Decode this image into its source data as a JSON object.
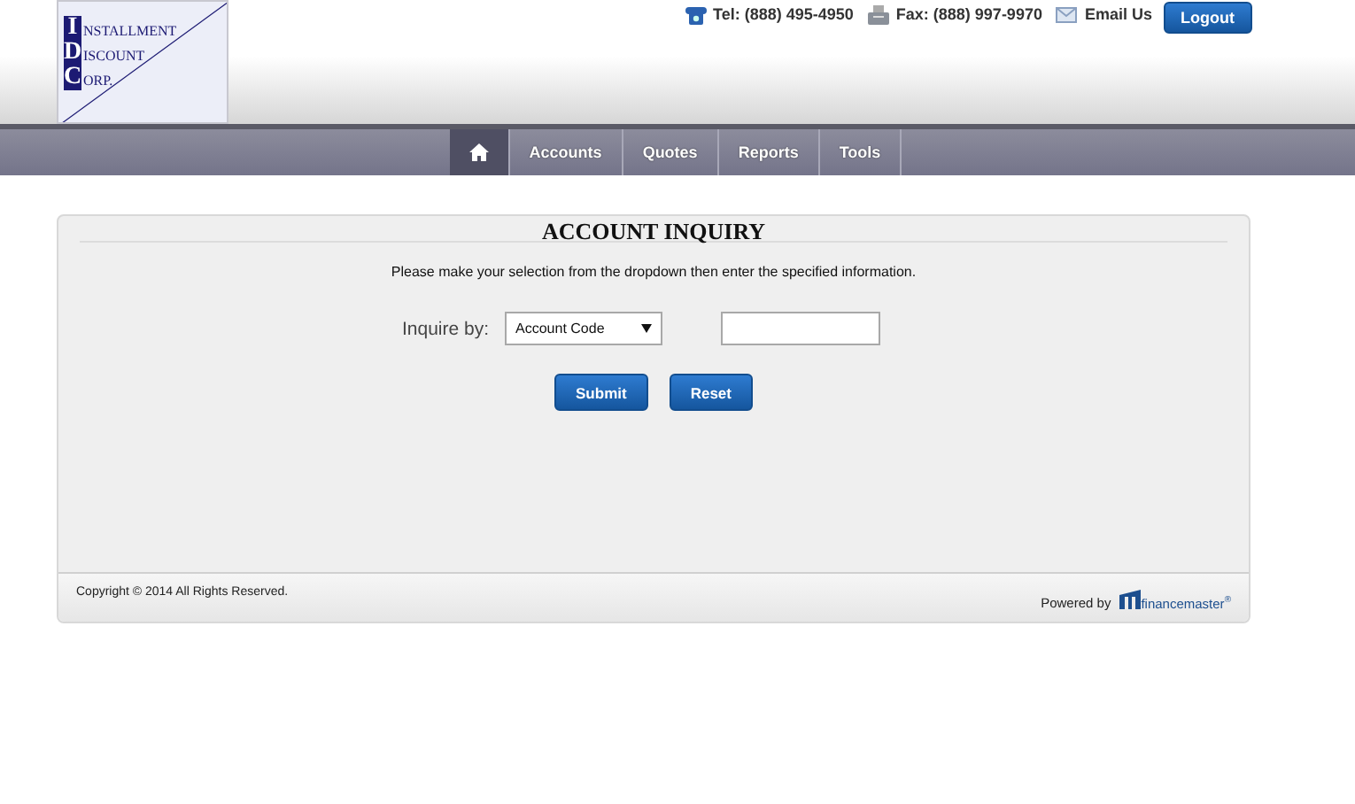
{
  "logo": {
    "lines": [
      {
        "initial": "I",
        "rest": "NSTALLMENT"
      },
      {
        "initial": "D",
        "rest": "ISCOUNT"
      },
      {
        "initial": "C",
        "rest": "ORP."
      }
    ]
  },
  "contact": {
    "phone": "Tel: (888) 495-4950",
    "fax": "Fax: (888) 997-9970",
    "email": "Email Us",
    "logout": "Logout"
  },
  "nav": [
    {
      "kind": "home",
      "selected": true
    },
    {
      "kind": "text",
      "label": "Accounts",
      "selected": false
    },
    {
      "kind": "text",
      "label": "Quotes",
      "selected": false
    },
    {
      "kind": "text",
      "label": "Reports",
      "selected": false
    },
    {
      "kind": "text",
      "label": "Tools",
      "selected": false
    }
  ],
  "panel": {
    "title": "ACCOUNT INQUIRY",
    "instructions": "Please make your selection from the dropdown then enter the specified information.",
    "inquire_label": "Inquire by:",
    "dropdown_value": "Account Code",
    "buttons": [
      "Submit",
      "Reset"
    ]
  },
  "footer": {
    "copyright": "Copyright © 2014 All Rights Reserved.",
    "powered_by": "Powered by",
    "brand": "financemaster$^{®}$"
  }
}
